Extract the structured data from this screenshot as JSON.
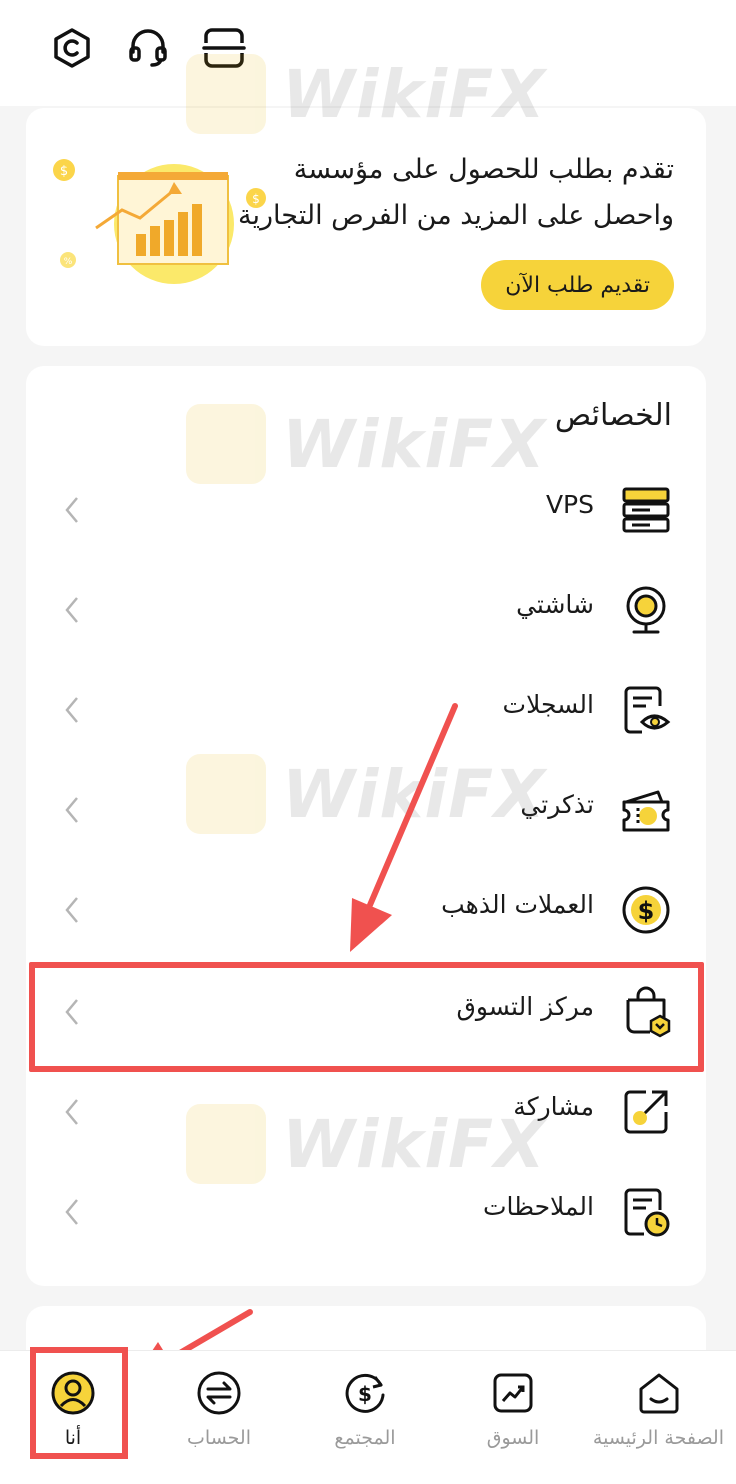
{
  "header": {
    "icons": [
      "settings-hex-icon",
      "headset-icon",
      "scan-icon"
    ]
  },
  "promo": {
    "line1": "تقدم بطلب للحصول على مؤسسة",
    "line2": "واحصل على المزيد من الفرص التجارية",
    "button_label": "تقديم طلب الآن"
  },
  "features": {
    "title": "الخصائص",
    "items": [
      {
        "label": "VPS",
        "icon": "server-icon"
      },
      {
        "label": "شاشتي",
        "icon": "webcam-icon"
      },
      {
        "label": "السجلات",
        "icon": "records-eye-icon"
      },
      {
        "label": "تذكرتي",
        "icon": "ticket-icon"
      },
      {
        "label": "العملات الذهب",
        "icon": "gold-coin-icon"
      },
      {
        "label": "مركز التسوق",
        "icon": "shopping-bag-icon"
      },
      {
        "label": "مشاركة",
        "icon": "share-icon"
      },
      {
        "label": "الملاحظات",
        "icon": "notes-clock-icon"
      }
    ]
  },
  "watermark": {
    "text": "WikiFX"
  },
  "tabbar": {
    "tabs": [
      {
        "label": "الصفحة الرئيسية",
        "icon": "home-icon",
        "active": false
      },
      {
        "label": "السوق",
        "icon": "market-icon",
        "active": false
      },
      {
        "label": "المجتمع",
        "icon": "community-icon",
        "active": false
      },
      {
        "label": "الحساب",
        "icon": "account-exchange-icon",
        "active": false
      },
      {
        "label": "أنا",
        "icon": "profile-icon",
        "active": true
      }
    ]
  },
  "colors": {
    "accent": "#f6d33a",
    "highlight": "#f0514f",
    "background": "#f5f5f5"
  }
}
